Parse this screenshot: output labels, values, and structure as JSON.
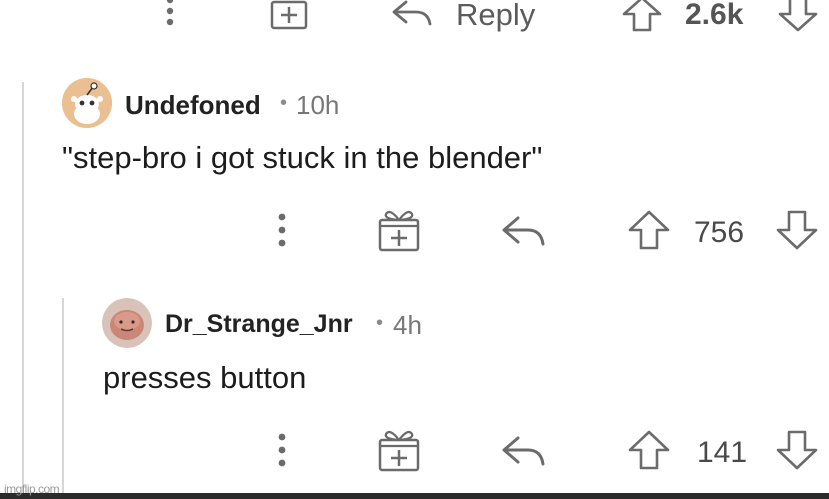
{
  "top_bar": {
    "reply_label": "Reply",
    "vote_count": "2.6k"
  },
  "comments": [
    {
      "username": "Undefoned",
      "separator": "•",
      "age": "10h",
      "body": "\"step-bro i got stuck in the blender\"",
      "vote_count": "756"
    },
    {
      "username": "Dr_Strange_Jnr",
      "separator": "•",
      "age": "4h",
      "body": "presses button",
      "vote_count": "141"
    }
  ],
  "watermark": "imgflip.com",
  "icons": {
    "more": "more-options-icon",
    "award": "award-gift-icon",
    "reply": "reply-arrow-icon",
    "upvote": "upvote-arrow-icon",
    "downvote": "downvote-arrow-icon"
  },
  "colors": {
    "text": "#1a1a1b",
    "icon": "#6b6b6b",
    "thread_line": "#d6d6d6"
  }
}
